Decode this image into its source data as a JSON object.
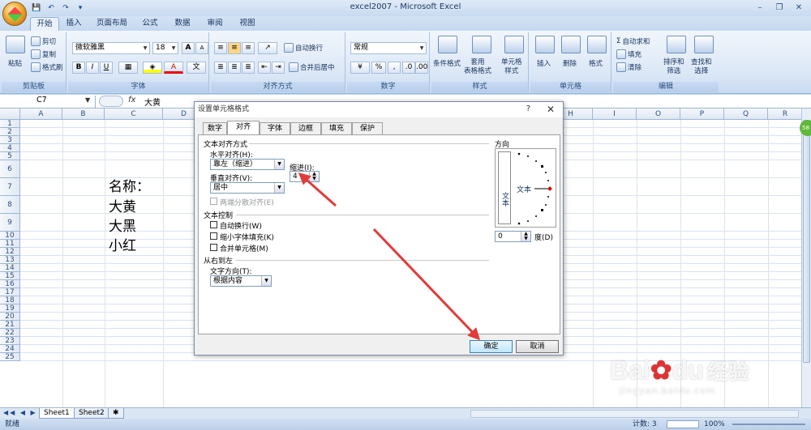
{
  "window": {
    "title": "excel2007 - Microsoft Excel",
    "minimize": "–",
    "restore": "❐",
    "close": "✕"
  },
  "qat": {
    "save": "💾",
    "undo": "↶",
    "redo": "↷",
    "more": "▾"
  },
  "tabs": [
    "开始",
    "插入",
    "页面布局",
    "公式",
    "数据",
    "审阅",
    "视图"
  ],
  "ribbon": {
    "clipboard": {
      "label": "剪贴板",
      "paste": "粘贴",
      "cut": "剪切",
      "copy": "复制",
      "format_painter": "格式刷"
    },
    "font": {
      "label": "字体",
      "name": "微软雅黑",
      "size": "18",
      "bold": "B",
      "italic": "I",
      "underline": "U",
      "grow": "A",
      "shrink": "A"
    },
    "align": {
      "label": "对齐方式",
      "wrap": "自动换行",
      "merge": "合并后居中"
    },
    "number": {
      "label": "数字",
      "format": "常规",
      "percent": "%"
    },
    "styles": {
      "label": "样式",
      "conditional": "条件格式",
      "table": "套用\n表格格式",
      "cell": "单元格\n样式"
    },
    "cells": {
      "label": "单元格",
      "insert": "插入",
      "delete": "删除",
      "format": "格式"
    },
    "editing": {
      "label": "编辑",
      "autosum": "自动求和",
      "fill": "填充",
      "clear": "清除",
      "sort": "排序和\n筛选",
      "find": "查找和\n选择"
    }
  },
  "formula_bar": {
    "name_box": "C7",
    "fx": "fx",
    "value": "大黄"
  },
  "columns": [
    "A",
    "B",
    "C",
    "D",
    "E",
    "F",
    "G",
    "H",
    "I",
    "J",
    "K",
    "L",
    "M",
    "N",
    "O",
    "P",
    "Q",
    "R"
  ],
  "rows": [
    "1",
    "2",
    "3",
    "4",
    "5",
    "6",
    "7",
    "8",
    "9",
    "10",
    "11",
    "12",
    "13",
    "14",
    "15",
    "16",
    "17",
    "18",
    "19",
    "20",
    "21",
    "22",
    "23",
    "24",
    "25"
  ],
  "cells": {
    "c6": "名称：",
    "c7": "大黄",
    "c8": "大黑",
    "c9": "小红"
  },
  "sheets": [
    "Sheet1",
    "Sheet2"
  ],
  "status": {
    "ready": "就绪",
    "count": "计数: 3",
    "zoom": "100%"
  },
  "dialog": {
    "title": "设置单元格格式",
    "help": "?",
    "close": "✕",
    "tabs": [
      "数字",
      "对齐",
      "字体",
      "边框",
      "填充",
      "保护"
    ],
    "text_align_section": "文本对齐方式",
    "horizontal_label": "水平对齐(H):",
    "horizontal_value": "靠左（缩进）",
    "vertical_label": "垂直对齐(V):",
    "vertical_value": "居中",
    "indent_label": "缩进(I):",
    "indent_value": "4",
    "distributed": "两端分散对齐(E)",
    "text_control_section": "文本控制",
    "wrap": "自动换行(W)",
    "shrink": "缩小字体填充(K)",
    "merge": "合并单元格(M)",
    "rtl_section": "从右到左",
    "direction_label": "文字方向(T):",
    "direction_value": "根据内容",
    "orientation_section": "方向",
    "vertical_text": "文本",
    "orient_text": "文本",
    "degrees_value": "0",
    "degrees_label": "度(D)",
    "ok": "确定",
    "cancel": "取消"
  },
  "watermark": {
    "brand": "Bai",
    "brand2": "du",
    "cn": "经验",
    "url": "jingyan.baidu.com"
  }
}
